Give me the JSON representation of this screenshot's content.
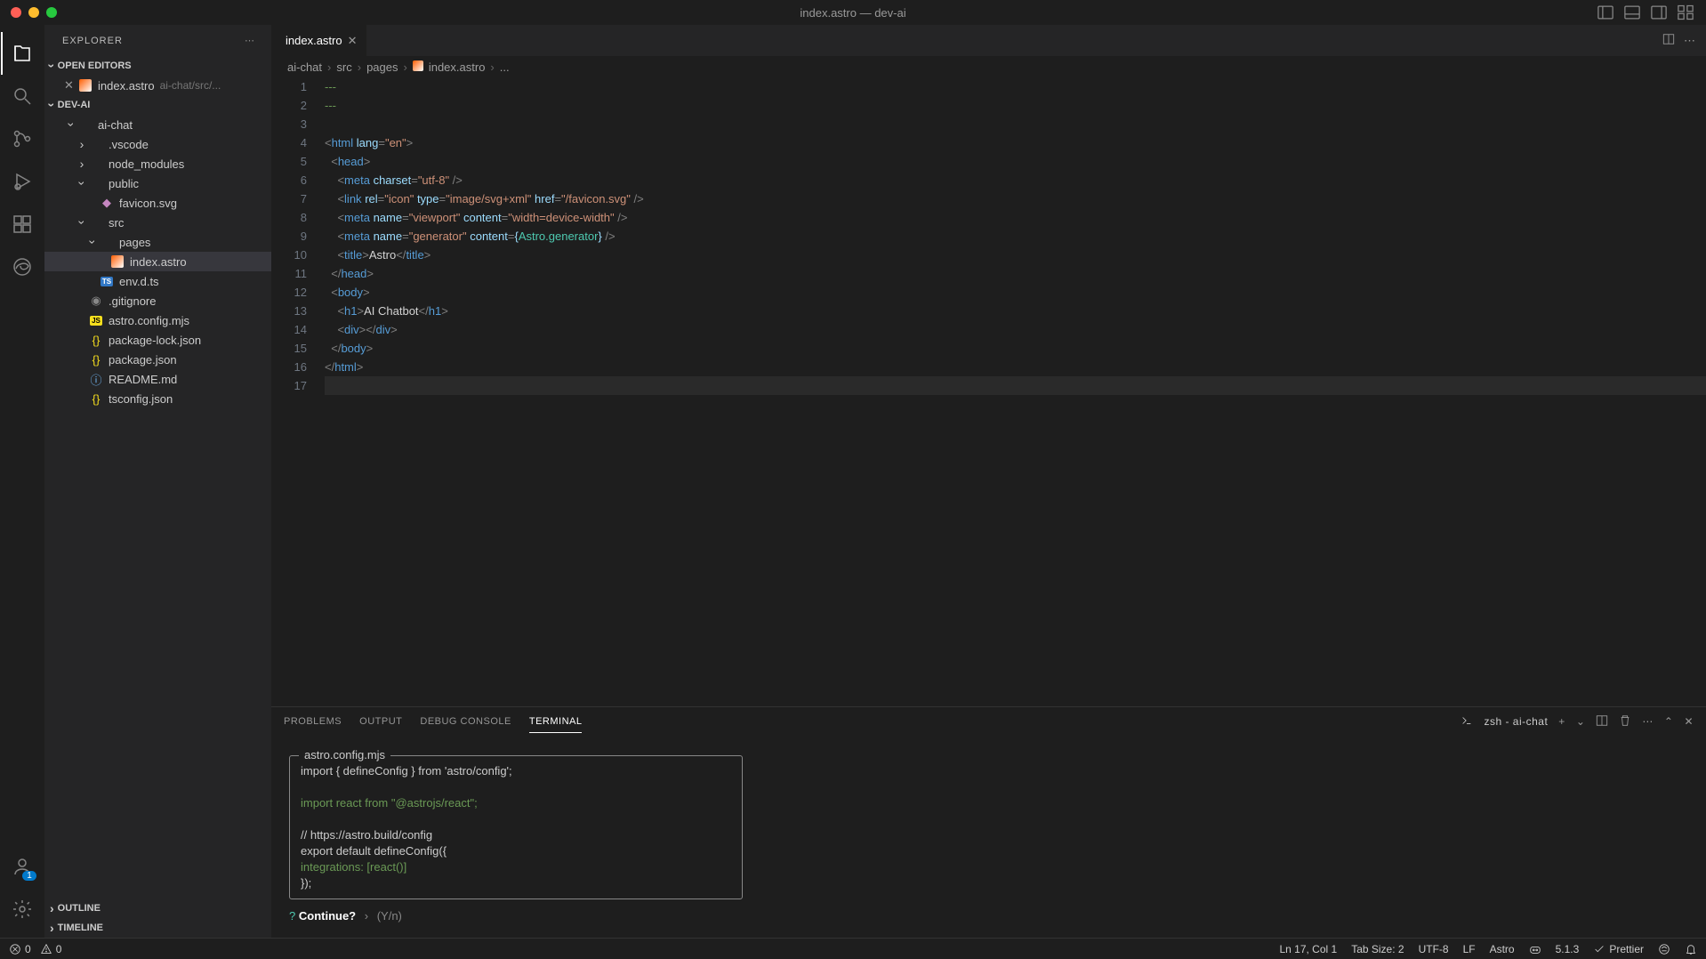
{
  "window": {
    "title": "index.astro — dev-ai"
  },
  "sidebar": {
    "title": "EXPLORER",
    "sections": {
      "open_editors": {
        "label": "OPEN EDITORS"
      },
      "workspace": {
        "label": "DEV-AI"
      },
      "outline": {
        "label": "OUTLINE"
      },
      "timeline": {
        "label": "TIMELINE"
      }
    },
    "open_editor_item": {
      "name": "index.astro",
      "hint": "ai-chat/src/..."
    },
    "tree": [
      {
        "name": "ai-chat",
        "type": "folder",
        "indent": 1,
        "expanded": true
      },
      {
        "name": ".vscode",
        "type": "folder",
        "indent": 2,
        "expanded": false
      },
      {
        "name": "node_modules",
        "type": "folder",
        "indent": 2,
        "expanded": false
      },
      {
        "name": "public",
        "type": "folder",
        "indent": 2,
        "expanded": true
      },
      {
        "name": "favicon.svg",
        "type": "file",
        "icon": "svg",
        "indent": 3
      },
      {
        "name": "src",
        "type": "folder",
        "indent": 2,
        "expanded": true
      },
      {
        "name": "pages",
        "type": "folder",
        "indent": 3,
        "expanded": true
      },
      {
        "name": "index.astro",
        "type": "file",
        "icon": "astro",
        "indent": 4,
        "selected": true
      },
      {
        "name": "env.d.ts",
        "type": "file",
        "icon": "ts",
        "indent": 3
      },
      {
        "name": ".gitignore",
        "type": "file",
        "icon": "git",
        "indent": 2
      },
      {
        "name": "astro.config.mjs",
        "type": "file",
        "icon": "js",
        "indent": 2
      },
      {
        "name": "package-lock.json",
        "type": "file",
        "icon": "json",
        "indent": 2
      },
      {
        "name": "package.json",
        "type": "file",
        "icon": "json",
        "indent": 2
      },
      {
        "name": "README.md",
        "type": "file",
        "icon": "info",
        "indent": 2
      },
      {
        "name": "tsconfig.json",
        "type": "file",
        "icon": "json",
        "indent": 2
      }
    ]
  },
  "tabs": {
    "active": {
      "name": "index.astro"
    }
  },
  "breadcrumb": {
    "parts": [
      "ai-chat",
      "src",
      "pages",
      "index.astro",
      "..."
    ]
  },
  "editor": {
    "lines": [
      {
        "n": 1,
        "tokens": [
          {
            "t": "---",
            "c": "comment"
          }
        ]
      },
      {
        "n": 2,
        "tokens": [
          {
            "t": "---",
            "c": "comment"
          }
        ]
      },
      {
        "n": 3,
        "tokens": []
      },
      {
        "n": 4,
        "tokens": [
          {
            "t": "<",
            "c": "punct"
          },
          {
            "t": "html",
            "c": "tag"
          },
          {
            "t": " ",
            "c": "text"
          },
          {
            "t": "lang",
            "c": "attr"
          },
          {
            "t": "=",
            "c": "punct"
          },
          {
            "t": "\"en\"",
            "c": "string"
          },
          {
            "t": ">",
            "c": "punct"
          }
        ]
      },
      {
        "n": 5,
        "tokens": [
          {
            "t": "  ",
            "c": "text"
          },
          {
            "t": "<",
            "c": "punct"
          },
          {
            "t": "head",
            "c": "tag"
          },
          {
            "t": ">",
            "c": "punct"
          }
        ]
      },
      {
        "n": 6,
        "tokens": [
          {
            "t": "    ",
            "c": "text"
          },
          {
            "t": "<",
            "c": "punct"
          },
          {
            "t": "meta",
            "c": "tag"
          },
          {
            "t": " ",
            "c": "text"
          },
          {
            "t": "charset",
            "c": "attr"
          },
          {
            "t": "=",
            "c": "punct"
          },
          {
            "t": "\"utf-8\"",
            "c": "string"
          },
          {
            "t": " />",
            "c": "punct"
          }
        ]
      },
      {
        "n": 7,
        "tokens": [
          {
            "t": "    ",
            "c": "text"
          },
          {
            "t": "<",
            "c": "punct"
          },
          {
            "t": "link",
            "c": "tag"
          },
          {
            "t": " ",
            "c": "text"
          },
          {
            "t": "rel",
            "c": "attr"
          },
          {
            "t": "=",
            "c": "punct"
          },
          {
            "t": "\"icon\"",
            "c": "string"
          },
          {
            "t": " ",
            "c": "text"
          },
          {
            "t": "type",
            "c": "attr"
          },
          {
            "t": "=",
            "c": "punct"
          },
          {
            "t": "\"image/svg+xml\"",
            "c": "string"
          },
          {
            "t": " ",
            "c": "text"
          },
          {
            "t": "href",
            "c": "attr"
          },
          {
            "t": "=",
            "c": "punct"
          },
          {
            "t": "\"/favicon.svg\"",
            "c": "string"
          },
          {
            "t": " />",
            "c": "punct"
          }
        ]
      },
      {
        "n": 8,
        "tokens": [
          {
            "t": "    ",
            "c": "text"
          },
          {
            "t": "<",
            "c": "punct"
          },
          {
            "t": "meta",
            "c": "tag"
          },
          {
            "t": " ",
            "c": "text"
          },
          {
            "t": "name",
            "c": "attr"
          },
          {
            "t": "=",
            "c": "punct"
          },
          {
            "t": "\"viewport\"",
            "c": "string"
          },
          {
            "t": " ",
            "c": "text"
          },
          {
            "t": "content",
            "c": "attr"
          },
          {
            "t": "=",
            "c": "punct"
          },
          {
            "t": "\"width=device-width\"",
            "c": "string"
          },
          {
            "t": " />",
            "c": "punct"
          }
        ]
      },
      {
        "n": 9,
        "tokens": [
          {
            "t": "    ",
            "c": "text"
          },
          {
            "t": "<",
            "c": "punct"
          },
          {
            "t": "meta",
            "c": "tag"
          },
          {
            "t": " ",
            "c": "text"
          },
          {
            "t": "name",
            "c": "attr"
          },
          {
            "t": "=",
            "c": "punct"
          },
          {
            "t": "\"generator\"",
            "c": "string"
          },
          {
            "t": " ",
            "c": "text"
          },
          {
            "t": "content",
            "c": "attr"
          },
          {
            "t": "=",
            "c": "punct"
          },
          {
            "t": "{",
            "c": "brace"
          },
          {
            "t": "Astro.generator",
            "c": "expr"
          },
          {
            "t": "}",
            "c": "brace"
          },
          {
            "t": " />",
            "c": "punct"
          }
        ]
      },
      {
        "n": 10,
        "tokens": [
          {
            "t": "    ",
            "c": "text"
          },
          {
            "t": "<",
            "c": "punct"
          },
          {
            "t": "title",
            "c": "tag"
          },
          {
            "t": ">",
            "c": "punct"
          },
          {
            "t": "Astro",
            "c": "text"
          },
          {
            "t": "</",
            "c": "punct"
          },
          {
            "t": "title",
            "c": "tag"
          },
          {
            "t": ">",
            "c": "punct"
          }
        ]
      },
      {
        "n": 11,
        "tokens": [
          {
            "t": "  ",
            "c": "text"
          },
          {
            "t": "</",
            "c": "punct"
          },
          {
            "t": "head",
            "c": "tag"
          },
          {
            "t": ">",
            "c": "punct"
          }
        ]
      },
      {
        "n": 12,
        "tokens": [
          {
            "t": "  ",
            "c": "text"
          },
          {
            "t": "<",
            "c": "punct"
          },
          {
            "t": "body",
            "c": "tag"
          },
          {
            "t": ">",
            "c": "punct"
          }
        ]
      },
      {
        "n": 13,
        "tokens": [
          {
            "t": "    ",
            "c": "text"
          },
          {
            "t": "<",
            "c": "punct"
          },
          {
            "t": "h1",
            "c": "tag"
          },
          {
            "t": ">",
            "c": "punct"
          },
          {
            "t": "AI Chatbot",
            "c": "text"
          },
          {
            "t": "</",
            "c": "punct"
          },
          {
            "t": "h1",
            "c": "tag"
          },
          {
            "t": ">",
            "c": "punct"
          }
        ]
      },
      {
        "n": 14,
        "tokens": [
          {
            "t": "    ",
            "c": "text"
          },
          {
            "t": "<",
            "c": "punct"
          },
          {
            "t": "div",
            "c": "tag"
          },
          {
            "t": ">",
            "c": "punct"
          },
          {
            "t": "</",
            "c": "punct"
          },
          {
            "t": "div",
            "c": "tag"
          },
          {
            "t": ">",
            "c": "punct"
          }
        ]
      },
      {
        "n": 15,
        "tokens": [
          {
            "t": "  ",
            "c": "text"
          },
          {
            "t": "</",
            "c": "punct"
          },
          {
            "t": "body",
            "c": "tag"
          },
          {
            "t": ">",
            "c": "punct"
          }
        ]
      },
      {
        "n": 16,
        "tokens": [
          {
            "t": "</",
            "c": "punct"
          },
          {
            "t": "html",
            "c": "tag"
          },
          {
            "t": ">",
            "c": "punct"
          }
        ]
      },
      {
        "n": 17,
        "tokens": [],
        "current": true
      }
    ]
  },
  "panel": {
    "tabs": {
      "problems": "PROBLEMS",
      "output": "OUTPUT",
      "debug": "DEBUG CONSOLE",
      "terminal": "TERMINAL"
    },
    "terminal_label": "zsh - ai-chat",
    "terminal": {
      "box_title": "astro.config.mjs",
      "lines": [
        {
          "t": "import { defineConfig } from 'astro/config';",
          "c": "default"
        },
        {
          "t": "",
          "c": "default"
        },
        {
          "t": "import react from \"@astrojs/react\";",
          "c": "green"
        },
        {
          "t": "",
          "c": "default"
        },
        {
          "t": "// https://astro.build/config",
          "c": "default"
        },
        {
          "t": "export default defineConfig({",
          "c": "default"
        },
        {
          "t": "  integrations: [react()]",
          "c": "green"
        },
        {
          "t": "});",
          "c": "default"
        }
      ],
      "prompt": {
        "q": "?",
        "label": "Continue?",
        "sep": "›",
        "hint": "(Y/n)"
      }
    }
  },
  "statusbar": {
    "errors": "0",
    "warnings": "0",
    "cursor": "Ln 17, Col 1",
    "tabsize": "Tab Size: 2",
    "encoding": "UTF-8",
    "eol": "LF",
    "lang": "Astro",
    "version": "5.1.3",
    "prettier": "Prettier"
  },
  "accounts_badge": "1"
}
